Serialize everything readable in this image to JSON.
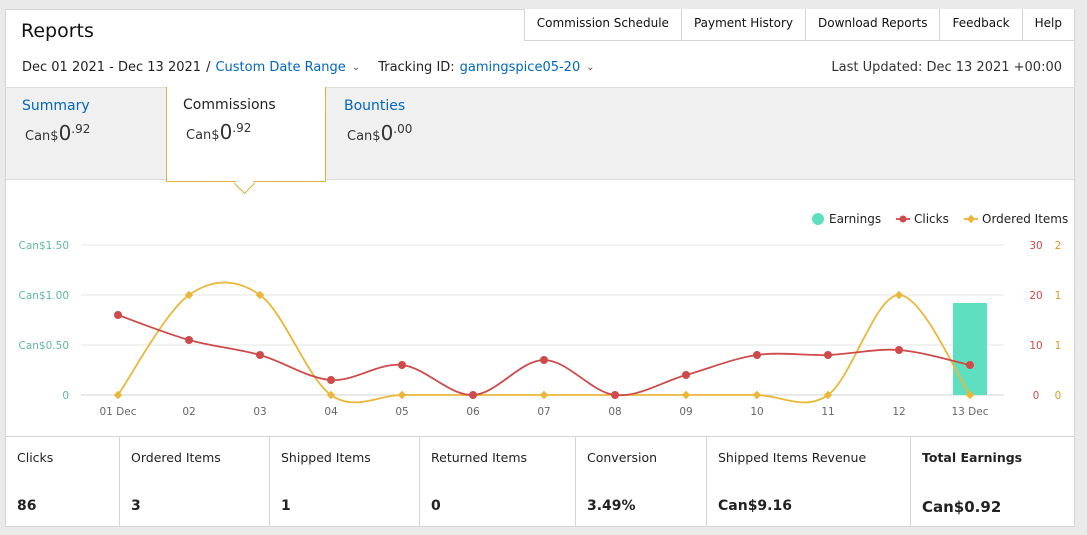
{
  "header": {
    "title": "Reports",
    "nav": [
      "Commission Schedule",
      "Payment History",
      "Download Reports",
      "Feedback",
      "Help"
    ],
    "date_range": "Dec 01 2021 - Dec 13 2021",
    "date_separator": "/",
    "custom_range_label": "Custom Date Range",
    "tracking_label": "Tracking ID:",
    "tracking_id": "gamingspice05-20",
    "last_updated": "Last Updated: Dec 13 2021 +00:00"
  },
  "tabs": {
    "summary": {
      "label": "Summary",
      "currency": "Can$",
      "whole": "0",
      "cents": ".92"
    },
    "commissions": {
      "label": "Commissions",
      "currency": "Can$",
      "whole": "0",
      "cents": ".92"
    },
    "bounties": {
      "label": "Bounties",
      "currency": "Can$",
      "whole": "0",
      "cents": ".00"
    }
  },
  "chart_data": {
    "type": "line",
    "categories": [
      "01 Dec",
      "02",
      "03",
      "04",
      "05",
      "06",
      "07",
      "08",
      "09",
      "10",
      "11",
      "12",
      "13 Dec"
    ],
    "left_axis_ticks": [
      "0",
      "Can$0.50",
      "Can$1.00",
      "Can$1.50"
    ],
    "clicks_axis_ticks": [
      "0",
      "10",
      "20",
      "30"
    ],
    "items_axis_ticks": [
      "0",
      "1",
      "1",
      "2"
    ],
    "series": [
      {
        "name": "Earnings",
        "type": "bar",
        "axis": "left",
        "color": "#5ee0c0",
        "values": [
          0,
          0,
          0,
          0,
          0,
          0,
          0,
          0,
          0,
          0,
          0,
          0,
          0.92
        ]
      },
      {
        "name": "Clicks",
        "type": "line",
        "axis": "clicks",
        "color": "#cf4a4a",
        "values": [
          16,
          11,
          8,
          3,
          6,
          0,
          7,
          0,
          4,
          8,
          8,
          9,
          6
        ]
      },
      {
        "name": "Ordered Items",
        "type": "line",
        "axis": "items",
        "color": "#eab73a",
        "values": [
          0,
          1,
          1,
          0,
          0,
          0,
          0,
          0,
          0,
          0,
          0,
          1,
          0
        ]
      }
    ],
    "ranges": {
      "left": [
        0,
        1.5
      ],
      "clicks": [
        0,
        30
      ],
      "items": [
        0,
        1.5
      ]
    },
    "legend_position": "top-right",
    "grid": true
  },
  "metrics": [
    {
      "label": "Clicks",
      "value": "86"
    },
    {
      "label": "Ordered Items",
      "value": "3"
    },
    {
      "label": "Shipped Items",
      "value": "1"
    },
    {
      "label": "Returned Items",
      "value": "0"
    },
    {
      "label": "Conversion",
      "value": "3.49%"
    },
    {
      "label": "Shipped Items Revenue",
      "value": "Can$9.16"
    },
    {
      "label": "Total Earnings",
      "value": "Can$0.92"
    }
  ],
  "colors": {
    "link": "#0066c0",
    "active_tab_border": "#e0b040",
    "left_axis_text": "#5fb8a4",
    "clicks_axis_text": "#cf4a4a",
    "items_axis_text": "#d69a2a"
  }
}
